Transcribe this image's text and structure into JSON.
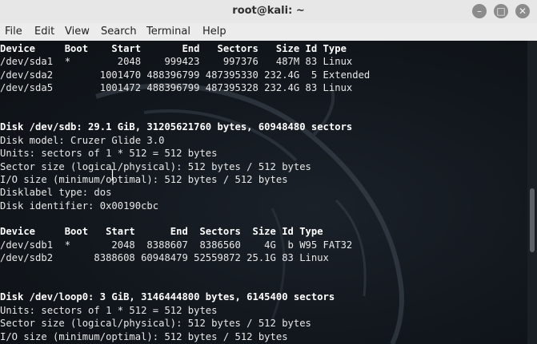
{
  "window": {
    "title": "root@kali: ~",
    "controls": {
      "minimize": "–",
      "maximize": "□",
      "close": "✕"
    }
  },
  "menubar": {
    "items": [
      "File",
      "Edit",
      "View",
      "Search",
      "Terminal",
      "Help"
    ]
  },
  "terminal": {
    "lines": [
      {
        "text": "Device     Boot    Start       End   Sectors   Size Id Type",
        "bold": true
      },
      {
        "text": "/dev/sda1  *        2048    999423    997376   487M 83 Linux",
        "bold": false
      },
      {
        "text": "/dev/sda2        1001470 488396799 487395330 232.4G  5 Extended",
        "bold": false
      },
      {
        "text": "/dev/sda5        1001472 488396799 487395328 232.4G 83 Linux",
        "bold": false
      },
      {
        "text": "",
        "bold": false
      },
      {
        "text": "",
        "bold": false
      },
      {
        "text": "Disk /dev/sdb: 29.1 GiB, 31205621760 bytes, 60948480 sectors",
        "bold": true
      },
      {
        "text": "Disk model: Cruzer Glide 3.0",
        "bold": false
      },
      {
        "text": "Units: sectors of 1 * 512 = 512 bytes",
        "bold": false
      },
      {
        "text": "Sector size (logical/physical): 512 bytes / 512 bytes",
        "bold": false
      },
      {
        "text": "I/O size (minimum/optimal): 512 bytes / 512 bytes",
        "bold": false
      },
      {
        "text": "Disklabel type: dos",
        "bold": false
      },
      {
        "text": "Disk identifier: 0x00190cbc",
        "bold": false
      },
      {
        "text": "",
        "bold": false
      },
      {
        "text": "Device     Boot   Start      End  Sectors  Size Id Type",
        "bold": true
      },
      {
        "text": "/dev/sdb1  *       2048  8388607  8386560    4G  b W95 FAT32",
        "bold": false
      },
      {
        "text": "/dev/sdb2       8388608 60948479 52559872 25.1G 83 Linux",
        "bold": false
      },
      {
        "text": "",
        "bold": false
      },
      {
        "text": "",
        "bold": false
      },
      {
        "text": "Disk /dev/loop0: 3 GiB, 3146444800 bytes, 6145400 sectors",
        "bold": true
      },
      {
        "text": "Units: sectors of 1 * 512 = 512 bytes",
        "bold": false
      },
      {
        "text": "Sector size (logical/physical): 512 bytes / 512 bytes",
        "bold": false
      },
      {
        "text": "I/O size (minimum/optimal): 512 bytes / 512 bytes",
        "bold": false
      }
    ]
  },
  "colors": {
    "terminal_bg": "#11161c",
    "terminal_fg": "#e8e8e8",
    "titlebar_bg": "#e7e7e7"
  },
  "icons": {
    "background": "kali-dragon-icon",
    "mouse": "text-cursor-icon"
  }
}
